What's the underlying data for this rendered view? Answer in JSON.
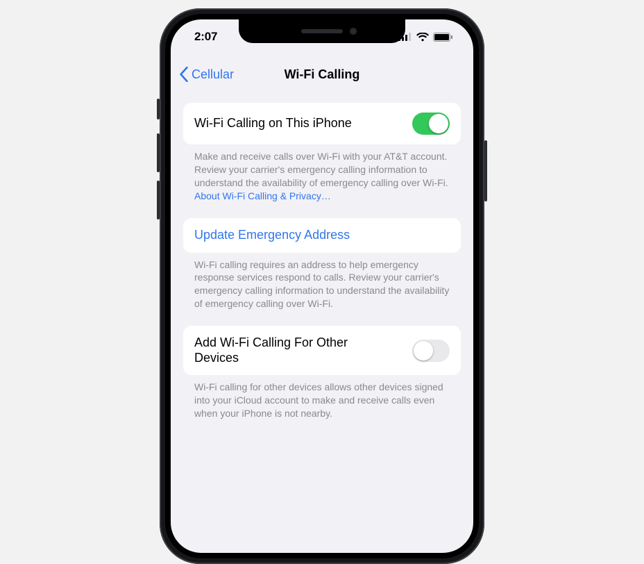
{
  "status_bar": {
    "time": "2:07"
  },
  "nav": {
    "back_label": "Cellular",
    "title": "Wi-Fi Calling"
  },
  "group1": {
    "label": "Wi-Fi Calling on This iPhone",
    "toggle_on": true,
    "footer_text": "Make and receive calls over Wi-Fi with your AT&T account. Review your carrier's emergency calling information to understand the availability of emergency calling over Wi-Fi. ",
    "footer_link": "About Wi-Fi Calling & Privacy…"
  },
  "group2": {
    "label": "Update Emergency Address",
    "footer_text": "Wi-Fi calling requires an address to help emergency response services respond to calls. Review your carrier's emergency calling information to understand the availability of emergency calling over Wi-Fi."
  },
  "group3": {
    "label": "Add Wi-Fi Calling For Other Devices",
    "toggle_on": false,
    "footer_text": "Wi-Fi calling for other devices allows other devices signed into your iCloud account to make and receive calls even when your iPhone is not nearby."
  }
}
